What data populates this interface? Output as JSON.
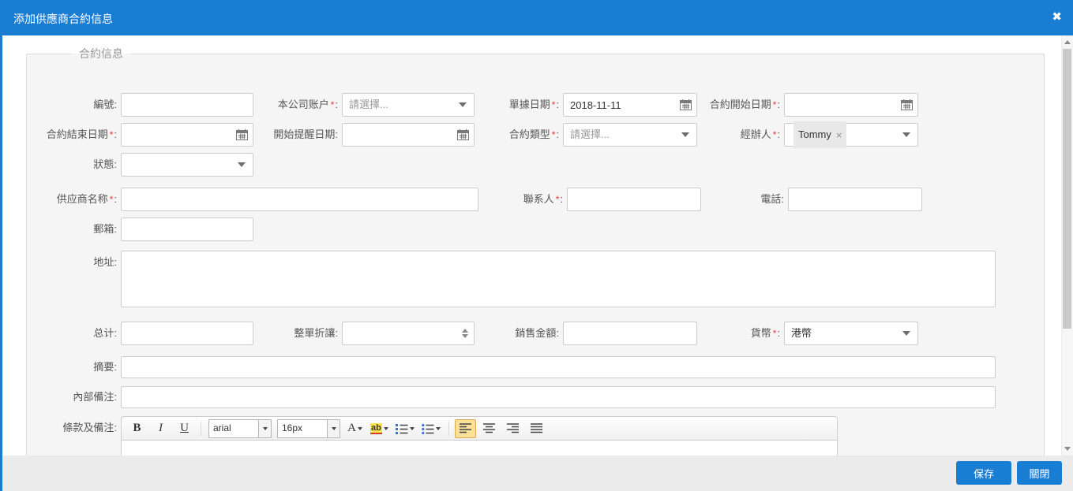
{
  "ui": {
    "colon": ":",
    "req": "*"
  },
  "icons": {
    "close": "✖",
    "remove": "×"
  },
  "colors": {
    "accent": "#1a7dd4",
    "required": "#e23a3a",
    "fieldset_bg": "#f5f5f5",
    "footer_bg": "#ebebeb",
    "toolbar_active_bg": "#fbe099"
  },
  "dialog": {
    "title": "添加供應商合約信息",
    "section_title": "合約信息",
    "buttons": {
      "save": "保存",
      "close": "關閉"
    }
  },
  "fields": {
    "code": {
      "label": "編號",
      "value": ""
    },
    "company_account": {
      "label": "本公司账户",
      "required": true,
      "placeholder": "請選擇..."
    },
    "doc_date": {
      "label": "單據日期",
      "required": true,
      "value": "2018-11-11"
    },
    "contract_start": {
      "label": "合約開始日期",
      "required": true,
      "value": ""
    },
    "contract_end": {
      "label": "合約結束日期",
      "required": true,
      "value": ""
    },
    "remind_start": {
      "label": "開始提醒日期",
      "value": ""
    },
    "contract_type": {
      "label": "合約類型",
      "required": true,
      "placeholder": "請選擇..."
    },
    "handler": {
      "label": "經辦人",
      "required": true,
      "tag": "Tommy"
    },
    "status": {
      "label": "狀態",
      "value": ""
    },
    "supplier_name": {
      "label": "供应商名称",
      "required": true,
      "value": ""
    },
    "contact": {
      "label": "聯系人",
      "required": true,
      "value": ""
    },
    "phone": {
      "label": "電話",
      "value": ""
    },
    "email": {
      "label": "郵箱",
      "value": ""
    },
    "address": {
      "label": "地址",
      "value": ""
    },
    "total": {
      "label": "总计",
      "value": ""
    },
    "discount": {
      "label": "整單折讓",
      "value": ""
    },
    "sales_amount": {
      "label": "銷售金額",
      "value": ""
    },
    "currency": {
      "label": "貨幣",
      "required": true,
      "value": "港幣"
    },
    "summary": {
      "label": "摘要",
      "value": ""
    },
    "internal_note": {
      "label": "內部備注",
      "value": ""
    },
    "terms_note": {
      "label": "條款及備注",
      "value": ""
    }
  },
  "editor": {
    "bold": "B",
    "italic": "I",
    "underline": "U",
    "font_name": "arial",
    "font_size": "16px",
    "color_letter": "A",
    "highlight_text": "ab"
  }
}
